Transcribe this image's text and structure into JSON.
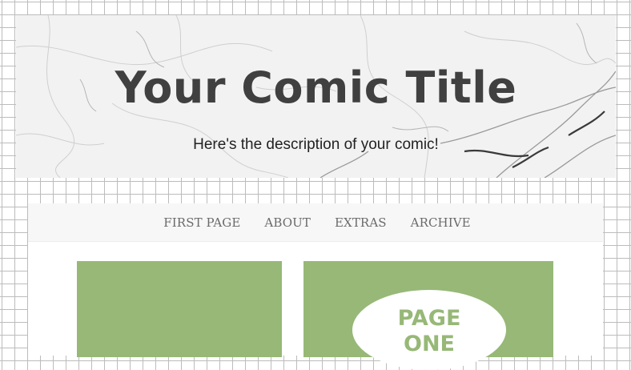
{
  "header": {
    "title": "Your Comic Title",
    "description": "Here's the description of your comic!"
  },
  "nav": {
    "items": [
      {
        "label": "FIRST PAGE"
      },
      {
        "label": "ABOUT"
      },
      {
        "label": "EXTRAS"
      },
      {
        "label": "ARCHIVE"
      }
    ]
  },
  "comic": {
    "bubble_line1": "PAGE",
    "bubble_line2": "ONE"
  },
  "colors": {
    "panel_green": "#97b877",
    "title_text": "#404040",
    "nav_text": "#6a6a6a",
    "grid_line": "#bcbcbc"
  }
}
